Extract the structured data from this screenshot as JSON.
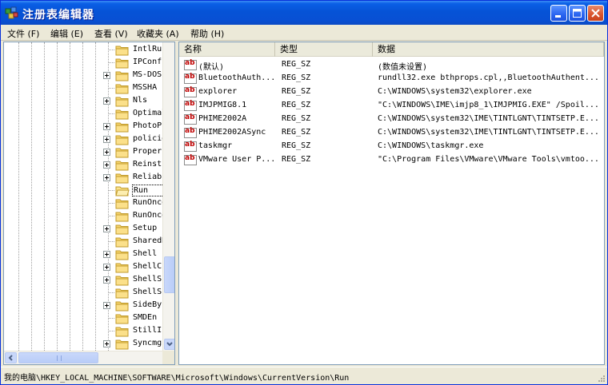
{
  "window": {
    "title": "注册表编辑器"
  },
  "menubar": [
    {
      "label": "文件 (F)"
    },
    {
      "label": "编辑 (E)"
    },
    {
      "label": "查看 (V)"
    },
    {
      "label": "收藏夹 (A)"
    },
    {
      "label": "帮助 (H)"
    }
  ],
  "tree": {
    "items": [
      {
        "label": "IntlRu",
        "expandable": false
      },
      {
        "label": "IPConf",
        "expandable": false
      },
      {
        "label": "MS-DOS",
        "expandable": true
      },
      {
        "label": "MSSHA",
        "expandable": false
      },
      {
        "label": "Nls",
        "expandable": true
      },
      {
        "label": "Optimal",
        "expandable": false
      },
      {
        "label": "PhotoPr",
        "expandable": true
      },
      {
        "label": "policie",
        "expandable": true
      },
      {
        "label": "Proper",
        "expandable": true
      },
      {
        "label": "Reinst",
        "expandable": true
      },
      {
        "label": "Reliab",
        "expandable": true
      },
      {
        "label": "Run",
        "expandable": false,
        "selected": true
      },
      {
        "label": "RunOnce",
        "expandable": false
      },
      {
        "label": "RunOnce",
        "expandable": false
      },
      {
        "label": "Setup",
        "expandable": true
      },
      {
        "label": "SharedD",
        "expandable": false
      },
      {
        "label": "Shell E",
        "expandable": true
      },
      {
        "label": "ShellC",
        "expandable": true
      },
      {
        "label": "ShellS",
        "expandable": true
      },
      {
        "label": "ShellS",
        "expandable": false
      },
      {
        "label": "SideBy",
        "expandable": true
      },
      {
        "label": "SMDEn",
        "expandable": false
      },
      {
        "label": "StillIr",
        "expandable": false
      },
      {
        "label": "Syncmgr",
        "expandable": true
      }
    ]
  },
  "list": {
    "columns": [
      "名称",
      "类型",
      "数据"
    ],
    "rows": [
      {
        "name": "(默认)",
        "type": "REG_SZ",
        "data": "(数值未设置)"
      },
      {
        "name": "BluetoothAuth...",
        "type": "REG_SZ",
        "data": "rundll32.exe bthprops.cpl,,BluetoothAuthent..."
      },
      {
        "name": "explorer",
        "type": "REG_SZ",
        "data": "C:\\WINDOWS\\system32\\explorer.exe"
      },
      {
        "name": "IMJPMIG8.1",
        "type": "REG_SZ",
        "data": "\"C:\\WINDOWS\\IME\\imjp8_1\\IMJPMIG.EXE\" /Spoil..."
      },
      {
        "name": "PHIME2002A",
        "type": "REG_SZ",
        "data": "C:\\WINDOWS\\system32\\IME\\TINTLGNT\\TINTSETP.E..."
      },
      {
        "name": "PHIME2002ASync",
        "type": "REG_SZ",
        "data": "C:\\WINDOWS\\system32\\IME\\TINTLGNT\\TINTSETP.E..."
      },
      {
        "name": "taskmgr",
        "type": "REG_SZ",
        "data": "C:\\WINDOWS\\taskmgr.exe"
      },
      {
        "name": "VMware User P...",
        "type": "REG_SZ",
        "data": "\"C:\\Program Files\\VMware\\VMware Tools\\vmtoo..."
      }
    ]
  },
  "statusbar": {
    "path": "我的电脑\\HKEY_LOCAL_MACHINE\\SOFTWARE\\Microsoft\\Windows\\CurrentVersion\\Run"
  },
  "icons": {
    "app": "registry-icon",
    "folder": "folder-icon",
    "value": "string-value-icon"
  },
  "colors": {
    "titlebar": "#0653d6",
    "close": "#d9532c",
    "window_bg": "#ece9d8"
  }
}
